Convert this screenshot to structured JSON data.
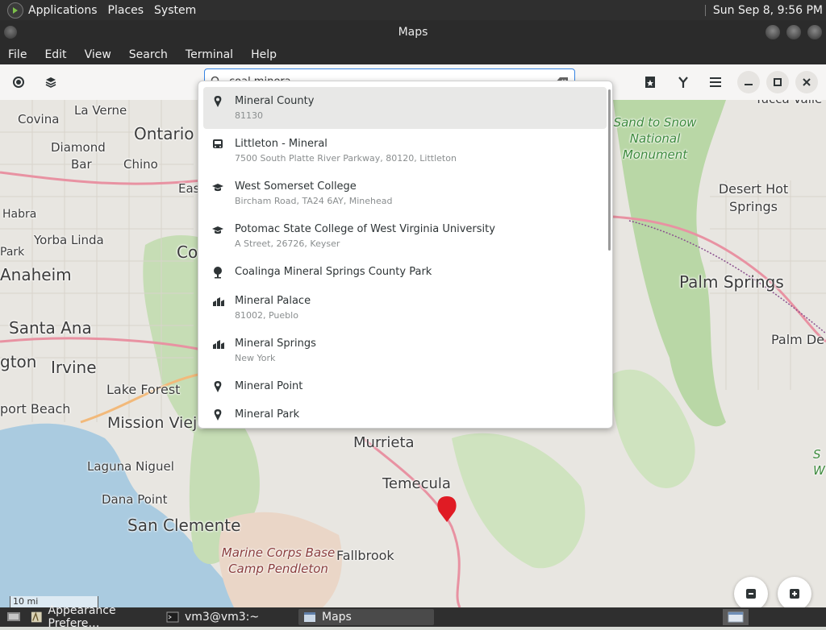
{
  "top_panel": {
    "menus": [
      "Applications",
      "Places",
      "System"
    ],
    "clock": "Sun Sep  8,  9:56 PM"
  },
  "window": {
    "title": "Maps"
  },
  "menubar": [
    "File",
    "Edit",
    "View",
    "Search",
    "Terminal",
    "Help"
  ],
  "headerbar": {
    "search_value": "coal minera",
    "icons": [
      "location-icon",
      "layers-icon",
      "favorites-icon",
      "route-icon",
      "menu-icon",
      "minimize-icon",
      "maximize-icon",
      "close-icon"
    ]
  },
  "search_results": [
    {
      "icon": "pin-icon",
      "name": "Mineral County",
      "detail": "81130"
    },
    {
      "icon": "bus-icon",
      "name": "Littleton - Mineral",
      "detail": "7500 South Platte River Parkway, 80120, Littleton"
    },
    {
      "icon": "school-icon",
      "name": "West Somerset College",
      "detail": "Bircham Road, TA24 6AY, Minehead"
    },
    {
      "icon": "school-icon",
      "name": "Potomac State College of West Virginia University",
      "detail": "A Street, 26726, Keyser"
    },
    {
      "icon": "park-icon",
      "name": "Coalinga Mineral Springs County Park",
      "detail": ""
    },
    {
      "icon": "building-icon",
      "name": "Mineral Palace",
      "detail": "81002, Pueblo"
    },
    {
      "icon": "building-icon",
      "name": "Mineral Springs",
      "detail": "New York"
    },
    {
      "icon": "pin-icon",
      "name": "Mineral Point",
      "detail": ""
    },
    {
      "icon": "pin-icon",
      "name": "Mineral Park",
      "detail": ""
    }
  ],
  "map": {
    "places": [
      "Covina",
      "La Verne",
      "Ontario",
      "Diamond",
      "Bar",
      "Chino",
      "Eas",
      "Habra",
      "Yorba Linda",
      "Park",
      "Co",
      "Anaheim",
      "Santa Ana",
      "Irvine",
      "gton",
      "Lake Forest",
      "port Beach",
      "Mission Viejo",
      "Laguna Niguel",
      "Dana Point",
      "San Clemente",
      "Murrieta",
      "Temecula",
      "Fallbrook",
      "Marine Corps Base Camp Pendleton",
      "Sand to Snow National Monument",
      "Desert Hot Springs",
      "Palm Springs",
      "Palm De",
      "S W",
      "Yucca Valle"
    ],
    "scale_label": "10 mi",
    "colors": {
      "water": "#a9c8dc",
      "park": "#b6d3a5",
      "land": "#e6e4de",
      "marker": "#e01b24"
    }
  },
  "taskbar": {
    "tasks": [
      {
        "label": "Appearance Prefere…",
        "icon": "appearance-icon"
      },
      {
        "label": "vm3@vm3:~",
        "icon": "terminal-icon"
      },
      {
        "label": "Maps",
        "icon": "maps-icon"
      }
    ]
  }
}
